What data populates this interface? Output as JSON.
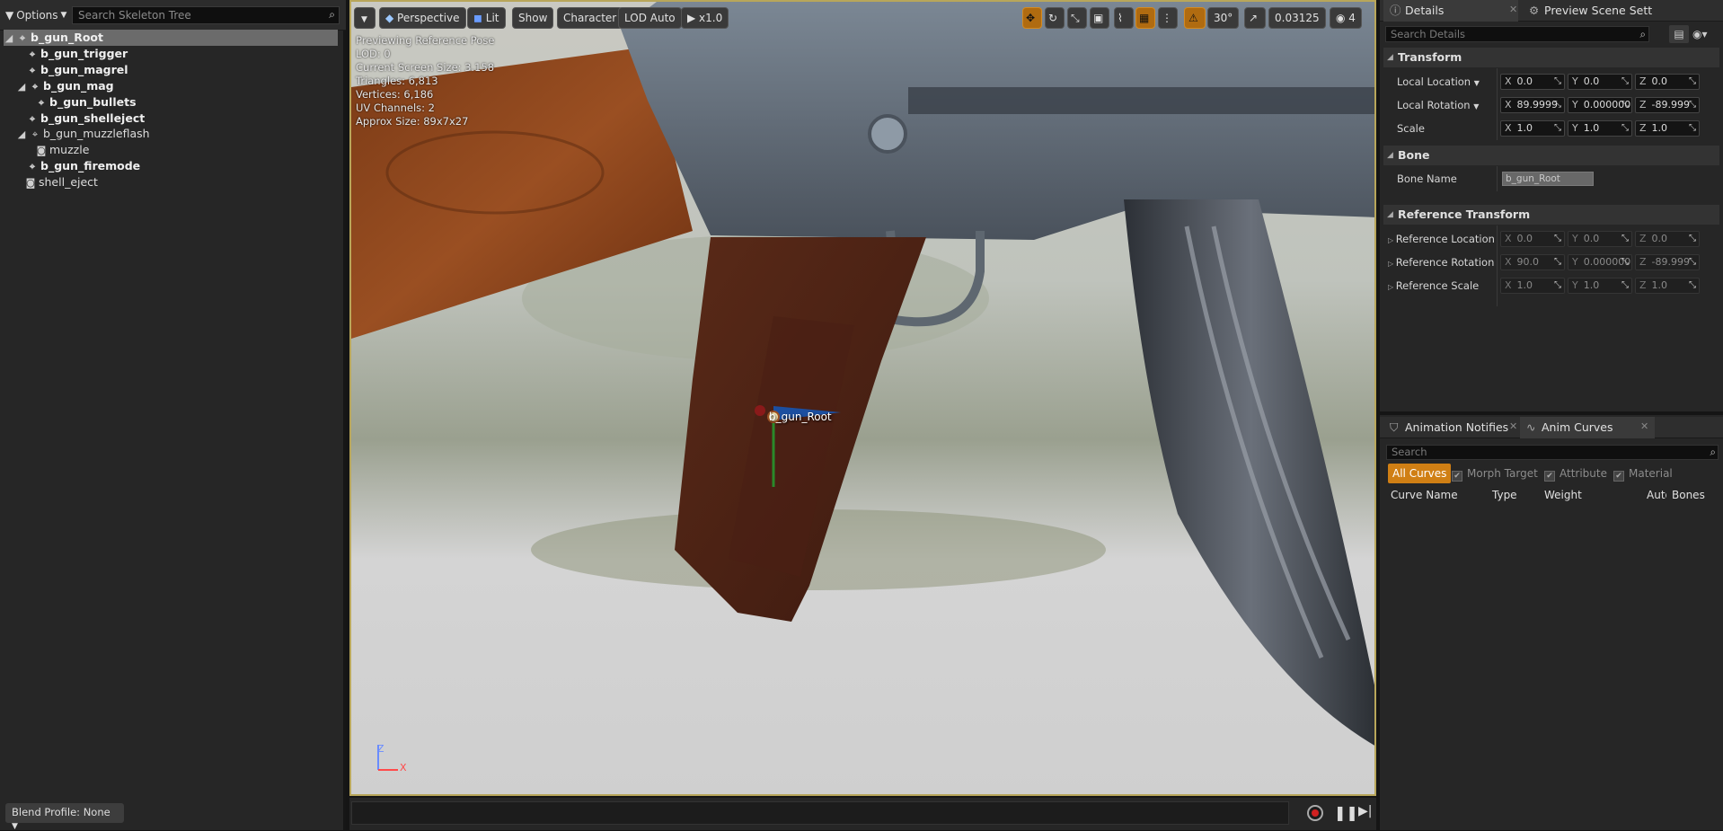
{
  "skeleton_tree": {
    "options_label": "Options",
    "search_placeholder": "Search Skeleton Tree",
    "bones": [
      {
        "name": "b_gun_Root",
        "bold": true,
        "selected": true
      },
      {
        "name": "b_gun_trigger",
        "bold": true
      },
      {
        "name": "b_gun_magrel",
        "bold": true
      },
      {
        "name": "b_gun_mag",
        "bold": true
      },
      {
        "name": "b_gun_bullets",
        "bold": true
      },
      {
        "name": "b_gun_shelleject",
        "bold": true
      },
      {
        "name": "b_gun_muzzleflash",
        "bold": false
      },
      {
        "name": "muzzle",
        "bold": false,
        "socket": true
      },
      {
        "name": "b_gun_firemode",
        "bold": true
      },
      {
        "name": "shell_eject",
        "bold": false,
        "socket": true
      }
    ],
    "blend_profile_label": "Blend Profile: None"
  },
  "viewport": {
    "toolbar": {
      "perspective": "Perspective",
      "lit": "Lit",
      "show": "Show",
      "character": "Character",
      "lod": "LOD Auto",
      "speed": "x1.0",
      "angle_snap": "30°",
      "scale_snap": "0.03125",
      "camera_speed": "4"
    },
    "info_lines": [
      "Previewing Reference Pose",
      "LOD: 0",
      "Current Screen Size: 3.158",
      "Triangles: 6,813",
      "Vertices: 6,186",
      "UV Channels: 2",
      "Approx Size: 89x7x27"
    ],
    "selected_bone_label": "b_gun_Root",
    "axis_z": "Z",
    "axis_x": "X"
  },
  "details": {
    "tab_details": "Details",
    "tab_preview": "Preview Scene Sett",
    "search_placeholder": "Search Details",
    "transform_header": "Transform",
    "local_location_label": "Local Location",
    "local_rotation_label": "Local Rotation",
    "scale_label": "Scale",
    "local_location": {
      "x": "0.0",
      "y": "0.0",
      "z": "0.0"
    },
    "local_rotation": {
      "x": "89.9999",
      "y": "0.000000",
      "z": "-89.999"
    },
    "scale": {
      "x": "1.0",
      "y": "1.0",
      "z": "1.0"
    },
    "bone_header": "Bone",
    "bone_name_label": "Bone Name",
    "bone_name_value": "b_gun_Root",
    "reference_header": "Reference Transform",
    "ref_location_label": "Reference Location",
    "ref_rotation_label": "Reference Rotation",
    "ref_scale_label": "Reference Scale",
    "ref_location": {
      "x": "0.0",
      "y": "0.0",
      "z": "0.0"
    },
    "ref_rotation": {
      "x": "90.0",
      "y": "0.000000",
      "z": "-89.999"
    },
    "ref_scale": {
      "x": "1.0",
      "y": "1.0",
      "z": "1.0"
    }
  },
  "curves": {
    "tab_notifies": "Animation Notifies",
    "tab_curves": "Anim Curves",
    "search_placeholder": "Search",
    "filter_all": "All Curves",
    "filter_morph": "Morph Target",
    "filter_attribute": "Attribute",
    "filter_material": "Material",
    "col_name": "Curve Name",
    "col_type": "Type",
    "col_weight": "Weight",
    "col_auto": "Auto",
    "col_bones": "Bones"
  },
  "colors": {
    "accent": "#d07f14",
    "viewport_border": "#b8a65a"
  }
}
